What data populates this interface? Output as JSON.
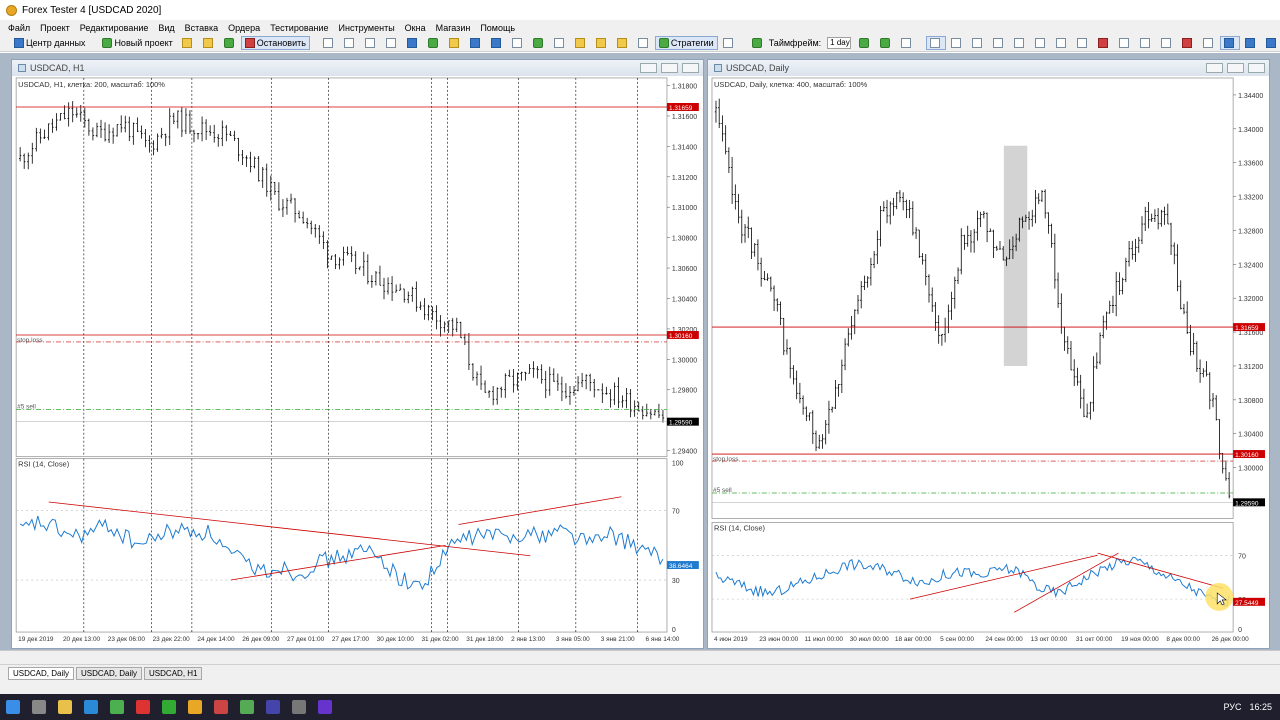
{
  "window": {
    "title": "Forex Tester 4  [USDCAD 2020]"
  },
  "menu": [
    "Файл",
    "Проект",
    "Редактирование",
    "Вид",
    "Вставка",
    "Ордера",
    "Тестирование",
    "Инструменты",
    "Окна",
    "Магазин",
    "Помощь"
  ],
  "toolbar": {
    "data_center": "Центр данных",
    "new_project": "Новый проект",
    "stop": "Остановить",
    "strategies": "Стратегии",
    "timeframe_label": "Таймфрейм:",
    "timeframe_value": "1 day"
  },
  "colors": {
    "price": "#000000",
    "rsi": "#1e7bd0",
    "level": "#cc0000",
    "sell": "#33aa33",
    "highlight": "#c8c8c8",
    "cursor": "#ffe066"
  },
  "charts": [
    {
      "id": "h1",
      "window_title": "USDCAD, H1",
      "info": "USDCAD, H1, клетка: 200, масштаб: 100%",
      "price_ticks": [
        "1.31800",
        "1.31600",
        "1.31400",
        "1.31200",
        "1.31000",
        "1.30800",
        "1.30600",
        "1.30400",
        "1.30200",
        "1.30000",
        "1.29800",
        "1.29600",
        "1.29400"
      ],
      "price_min": 1.2936,
      "price_max": 1.3185,
      "level_price": 1.31659,
      "level_tag": "1.31659",
      "stop_price": 1.3016,
      "stop_tag": "1.30160",
      "stop_label": "stop loss",
      "sell_price": 1.2967,
      "sell_label": "#5 sell",
      "current_price": 1.2959,
      "current_tag": "1.29590",
      "trend_points": [
        1.3132,
        1.315,
        1.3163,
        1.3148,
        1.3155,
        1.314,
        1.3158,
        1.3152,
        1.3148,
        1.313,
        1.3105,
        1.3095,
        1.307,
        1.3062,
        1.3052,
        1.3045,
        1.303,
        1.302,
        1.2975,
        1.2985,
        1.299,
        1.298,
        1.2986,
        1.2978,
        1.297,
        1.2962
      ],
      "rsi_label": "RSI (14, Close)",
      "rsi_ticks": [
        "100",
        "70",
        "30",
        "0"
      ],
      "rsi_value_tag": "38.6464",
      "rsi_points": [
        58,
        63,
        60,
        55,
        57,
        62,
        55,
        50,
        56,
        59,
        58,
        57,
        45,
        40,
        35,
        38,
        33,
        40,
        42,
        45,
        47,
        40,
        30,
        26,
        38,
        52,
        55,
        57,
        54,
        58,
        55,
        60,
        55,
        52,
        56,
        52,
        46,
        42
      ],
      "rsi_lines": [
        [
          0.05,
          75,
          0.79,
          44
        ],
        [
          0.33,
          30,
          0.66,
          50
        ],
        [
          0.68,
          62,
          0.93,
          78
        ]
      ],
      "vlines": [
        0.104,
        0.208,
        0.27,
        0.392,
        0.48,
        0.638,
        0.663,
        0.772,
        0.86,
        0.955
      ],
      "xlabels": [
        "19 дек 2019",
        "20 дек 13:00",
        "23 дек 06:00",
        "23 дек 22:00",
        "24 дек 14:00",
        "26 дек 09:00",
        "27 дек 01:00",
        "27 дек 17:00",
        "30 дек 10:00",
        "31 дек 02:00",
        "31 дек 18:00",
        "2 янв 13:00",
        "3 янв 05:00",
        "3 янв 21:00",
        "6 янв 14:00"
      ]
    },
    {
      "id": "d1",
      "window_title": "USDCAD, Daily",
      "info": "USDCAD, Daily, клетка: 400, масштаб: 100%",
      "price_ticks": [
        "1.34400",
        "1.34000",
        "1.33600",
        "1.33200",
        "1.32800",
        "1.32400",
        "1.32000",
        "1.31600",
        "1.31200",
        "1.30800",
        "1.30400",
        "1.30000",
        "1.29600"
      ],
      "price_min": 1.294,
      "price_max": 1.346,
      "level_price": 1.31659,
      "level_tag": "1.31659",
      "stop_price": 1.3016,
      "stop_tag": "1.30160",
      "stop_label": "stop loss",
      "sell_price": 1.297,
      "sell_label": "#5 sell",
      "current_price": 1.2959,
      "current_tag": "1.29590",
      "trend_points": [
        1.342,
        1.33,
        1.325,
        1.318,
        1.308,
        1.303,
        1.311,
        1.32,
        1.329,
        1.333,
        1.325,
        1.315,
        1.327,
        1.329,
        1.324,
        1.33,
        1.332,
        1.314,
        1.306,
        1.318,
        1.324,
        1.33,
        1.329,
        1.315,
        1.31,
        1.296
      ],
      "highlight": [
        0.56,
        0.605
      ],
      "rsi_label": "RSI (14, Close)",
      "rsi_ticks": [
        "70",
        "30",
        "0"
      ],
      "rsi_value_tag": "27.5449",
      "rsi_points": [
        50,
        45,
        38,
        35,
        42,
        48,
        55,
        62,
        60,
        57,
        50,
        45,
        52,
        55,
        50,
        58,
        55,
        40,
        35,
        45,
        55,
        62,
        66,
        58,
        48,
        40,
        30,
        28
      ],
      "rsi_lines": [
        [
          0.38,
          30,
          0.74,
          70
        ],
        [
          0.58,
          18,
          0.78,
          72
        ],
        [
          0.74,
          72,
          0.98,
          40
        ]
      ],
      "xlabels": [
        "4 июн 2019",
        "23 июн 00:00",
        "11 июл 00:00",
        "30 июл 00:00",
        "18 авг 00:00",
        "5 сен 00:00",
        "24 сен 00:00",
        "13 окт 00:00",
        "31 окт 00:00",
        "19 ноя 00:00",
        "8 дек 00:00",
        "26 дек 00:00"
      ]
    }
  ],
  "tabs": [
    "USDCAD, Daily",
    "USDCAD, Daily",
    "USDCAD, H1"
  ],
  "tray": {
    "lang": "РУС",
    "time": "16:25"
  }
}
